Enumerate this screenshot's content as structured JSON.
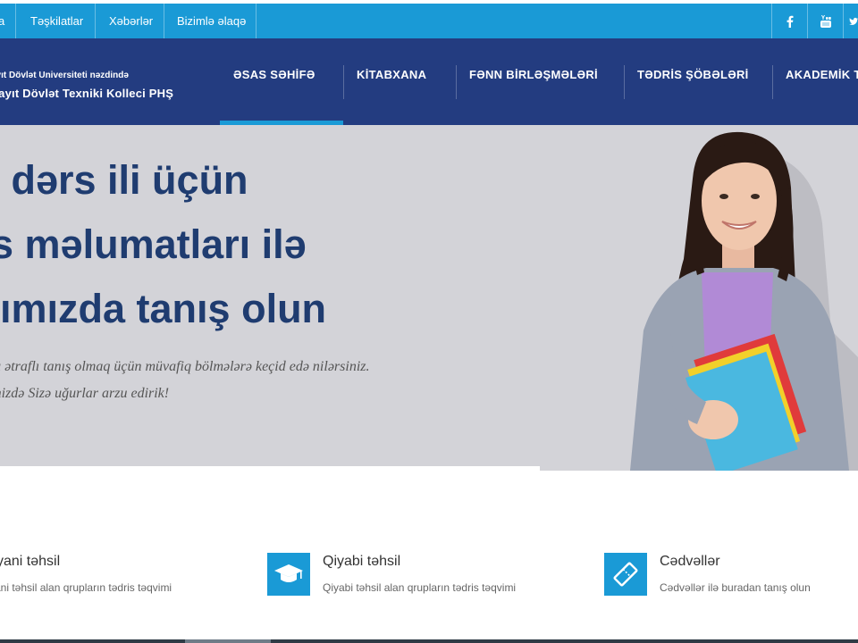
{
  "topbar": {
    "links": [
      "a",
      "Təşkilatlar",
      "Xəbərlər",
      "Bizimlə əlaqə"
    ],
    "social": [
      "facebook-icon",
      "youtube-icon",
      "twitter-icon"
    ]
  },
  "logo": {
    "line1": "ayıt Dövlət Universiteti nəzdində",
    "line2": "qayıt Dövlət Texniki Kolleci PHŞ"
  },
  "nav": {
    "items": [
      "ƏSAS SƏHİFƏ",
      "KİTABXANA",
      "FƏNN BİRLƏŞMƏLƏRİ",
      "TƏDRİS ŞÖBƏLƏRİ",
      "AKADEMİK TƏ"
    ],
    "active_index": 0
  },
  "hero": {
    "heading": [
      "ni dərs ili üçün",
      "ris məlumatları ilə",
      "ytımızda tanış olun"
    ],
    "subtitle": [
      "larla ətraflı tanış olmaq üçün müvafiq bölmələrə keçid edə nilərsiniz.",
      "s ilinizdə Sizə uğurlar arzu edirik!"
    ]
  },
  "features": [
    {
      "title": "yani təhsil",
      "desc": "ani təhsil alan qrupların tədris təqvimi",
      "icon": ""
    },
    {
      "title": "Qiyabi təhsil",
      "desc": "Qiyabi təhsil alan qrupların tədris təqvimi",
      "icon": "graduation-cap-icon"
    },
    {
      "title": "Cədvəllər",
      "desc": "Cədvəllər ilə buradan tanış olun",
      "icon": "ticket-icon"
    }
  ],
  "colors": {
    "topbar": "#1a9ad6",
    "header": "#233c80",
    "hero_bg": "#d3d3d8",
    "heading": "#1f3c70",
    "accent": "#1a9ad6"
  }
}
